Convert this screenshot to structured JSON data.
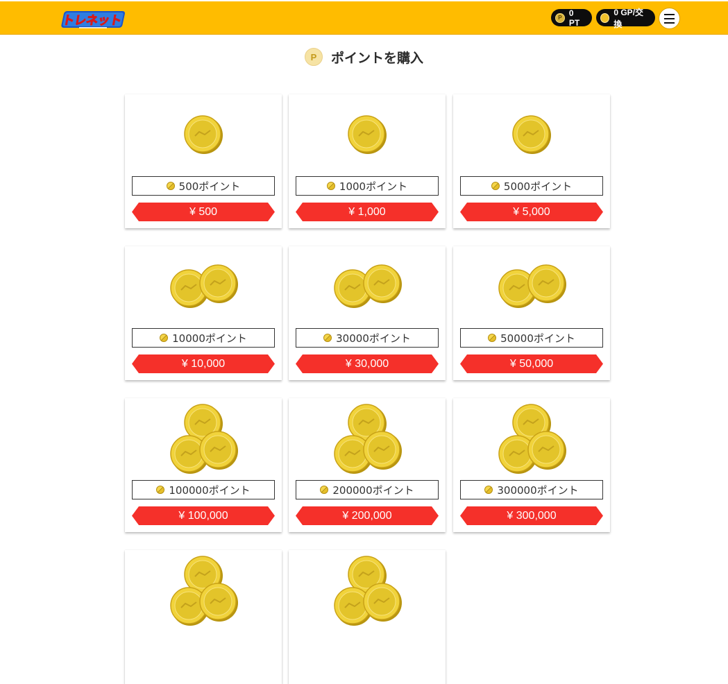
{
  "header": {
    "logo_text": "トレネット",
    "points_pill": "0 PT",
    "points_pill_icon": "P",
    "gp_pill": "0 GP/交換",
    "menu_icon": "hamburger-icon"
  },
  "page": {
    "title_icon": "P",
    "title": "ポイントを購入"
  },
  "packages": [
    {
      "label": "500ポイント",
      "price": "¥ 500",
      "coins": 1
    },
    {
      "label": "1000ポイント",
      "price": "¥ 1,000",
      "coins": 1
    },
    {
      "label": "5000ポイント",
      "price": "¥ 5,000",
      "coins": 1
    },
    {
      "label": "10000ポイント",
      "price": "¥ 10,000",
      "coins": 2
    },
    {
      "label": "30000ポイント",
      "price": "¥ 30,000",
      "coins": 2
    },
    {
      "label": "50000ポイント",
      "price": "¥ 50,000",
      "coins": 2
    },
    {
      "label": "100000ポイント",
      "price": "¥ 100,000",
      "coins": 3
    },
    {
      "label": "200000ポイント",
      "price": "¥ 200,000",
      "coins": 3
    },
    {
      "label": "300000ポイント",
      "price": "¥ 300,000",
      "coins": 3
    },
    {
      "label": "",
      "price": "",
      "coins": 3
    },
    {
      "label": "",
      "price": "",
      "coins": 3
    }
  ],
  "colors": {
    "header_bg": "#ffbc00",
    "price_bg": "#f5302a",
    "coin": "#e3c42a"
  }
}
